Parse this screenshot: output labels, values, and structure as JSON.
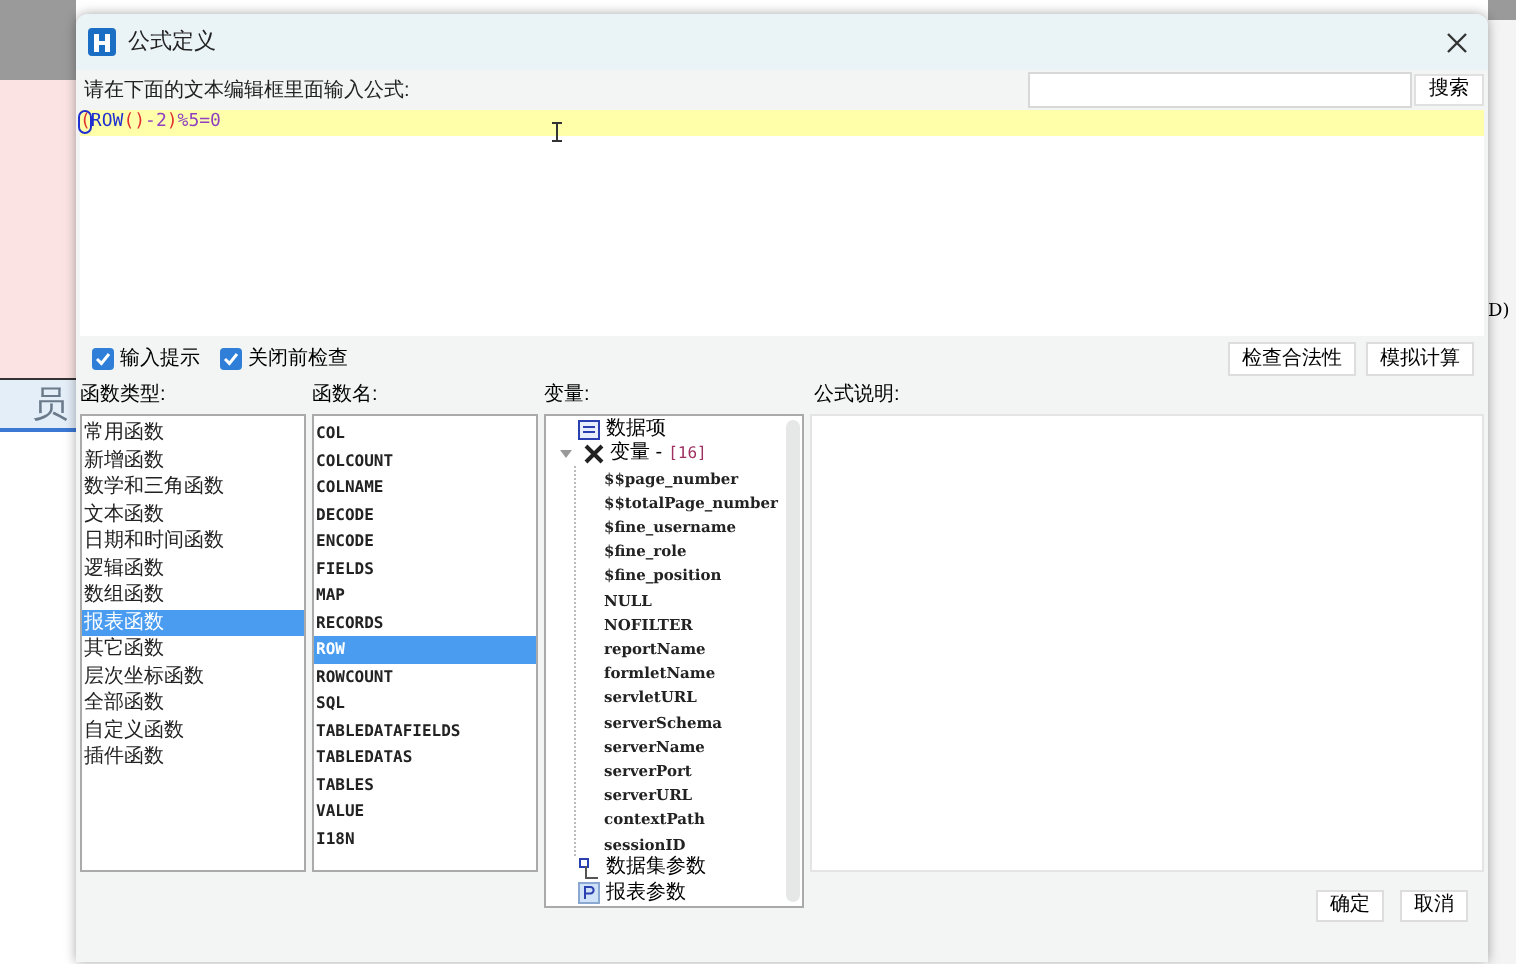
{
  "background": {
    "cell_text": "员",
    "edge_text": "D)"
  },
  "window": {
    "title": "公式定义"
  },
  "prompt": "请在下面的文本编辑框里面输入公式:",
  "search": {
    "button": "搜索"
  },
  "formula": [
    {
      "text": "(",
      "kind": "paren",
      "selected": true
    },
    {
      "text": "ROW",
      "kind": "function",
      "selected": false
    },
    {
      "text": "()",
      "kind": "paren",
      "selected": false
    },
    {
      "text": "-2",
      "kind": "number",
      "selected": false
    },
    {
      "text": ")",
      "kind": "paren",
      "selected": false
    },
    {
      "text": "%5=0",
      "kind": "number",
      "selected": false
    }
  ],
  "options": [
    {
      "label": "输入提示",
      "checked": true
    },
    {
      "label": "关闭前检查",
      "checked": true
    }
  ],
  "actions": [
    "检查合法性",
    "模拟计算"
  ],
  "function_types": {
    "label": "函数类型:",
    "items": [
      {
        "text": "常用函数",
        "selected": false
      },
      {
        "text": "新增函数",
        "selected": false
      },
      {
        "text": "数学和三角函数",
        "selected": false
      },
      {
        "text": "文本函数",
        "selected": false
      },
      {
        "text": "日期和时间函数",
        "selected": false
      },
      {
        "text": "逻辑函数",
        "selected": false
      },
      {
        "text": "数组函数",
        "selected": false
      },
      {
        "text": "报表函数",
        "selected": true
      },
      {
        "text": "其它函数",
        "selected": false
      },
      {
        "text": "层次坐标函数",
        "selected": false
      },
      {
        "text": "全部函数",
        "selected": false
      },
      {
        "text": "自定义函数",
        "selected": false
      },
      {
        "text": "插件函数",
        "selected": false
      }
    ]
  },
  "function_names": {
    "label": "函数名:",
    "items": [
      {
        "text": "COL",
        "selected": false
      },
      {
        "text": "COLCOUNT",
        "selected": false
      },
      {
        "text": "COLNAME",
        "selected": false
      },
      {
        "text": "DECODE",
        "selected": false
      },
      {
        "text": "ENCODE",
        "selected": false
      },
      {
        "text": "FIELDS",
        "selected": false
      },
      {
        "text": "MAP",
        "selected": false
      },
      {
        "text": "RECORDS",
        "selected": false
      },
      {
        "text": "ROW",
        "selected": true
      },
      {
        "text": "ROWCOUNT",
        "selected": false
      },
      {
        "text": "SQL",
        "selected": false
      },
      {
        "text": "TABLEDATAFIELDS",
        "selected": false
      },
      {
        "text": "TABLEDATAS",
        "selected": false
      },
      {
        "text": "TABLES",
        "selected": false
      },
      {
        "text": "VALUE",
        "selected": false
      },
      {
        "text": "I18N",
        "selected": false
      }
    ]
  },
  "variables": {
    "label": "变量:",
    "tree": [
      {
        "label": "数据项",
        "kind": "data"
      },
      {
        "label": "变量 -",
        "count": "[16]",
        "kind": "variables",
        "expanded": true,
        "children": [
          {
            "label": "$$page_number"
          },
          {
            "label": "$$totalPage_number"
          },
          {
            "label": "$fine_username"
          },
          {
            "label": "$fine_role"
          },
          {
            "label": "$fine_position"
          },
          {
            "label": "NULL"
          },
          {
            "label": "NOFILTER"
          },
          {
            "label": "reportName"
          },
          {
            "label": "formletName"
          },
          {
            "label": "servletURL"
          },
          {
            "label": "serverSchema"
          },
          {
            "label": "serverName"
          },
          {
            "label": "serverPort"
          },
          {
            "label": "serverURL"
          },
          {
            "label": "contextPath"
          },
          {
            "label": "sessionID"
          }
        ]
      },
      {
        "label": "数据集参数",
        "kind": "dataset"
      },
      {
        "label": "报表参数",
        "kind": "param"
      }
    ]
  },
  "description": {
    "label": "公式说明:"
  },
  "buttons": [
    "确定",
    "取消"
  ]
}
